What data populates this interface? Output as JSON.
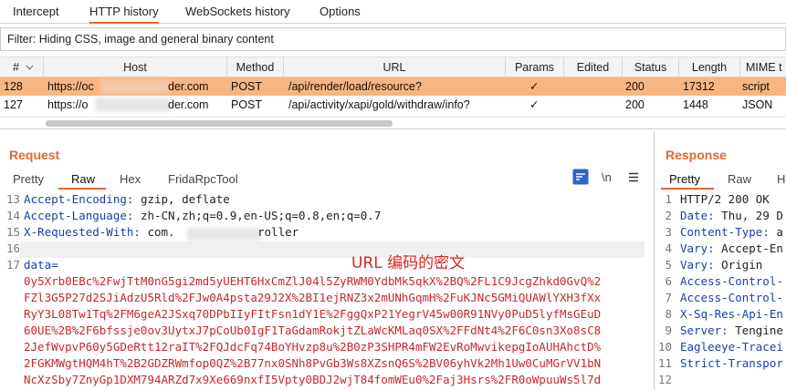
{
  "topnav": {
    "tabs": [
      "Intercept",
      "HTTP history",
      "WebSockets history",
      "Options"
    ]
  },
  "filter": {
    "text": "Filter: Hiding CSS, image and general binary content"
  },
  "table": {
    "headers": [
      "#",
      "Host",
      "Method",
      "URL",
      "Params",
      "Edited",
      "Status",
      "Length",
      "MIME t"
    ],
    "rows": [
      {
        "num": "128",
        "host_start": "https://oc",
        "host_end": "der.com",
        "method": "POST",
        "url": "/api/render/load/resource?",
        "params": "✓",
        "edited": "",
        "status": "200",
        "length": "17312",
        "mime": "script",
        "selected": true
      },
      {
        "num": "127",
        "host_start": "https://o",
        "host_end": "der.com",
        "method": "POST",
        "url": "/api/activity/xapi/gold/withdraw/info?",
        "params": "✓",
        "edited": "",
        "status": "200",
        "length": "1448",
        "mime": "JSON",
        "selected": false
      }
    ]
  },
  "request": {
    "title": "Request",
    "tabs": [
      "Pretty",
      "Raw",
      "Hex",
      "FridaRpcTool"
    ],
    "active_tab": "Raw",
    "newline_toggle": "\\n",
    "lines": [
      {
        "n": "13",
        "key": "Accept-Encoding",
        "val": " gzip, deflate"
      },
      {
        "n": "14",
        "key": "Accept-Language",
        "val": " zh-CN,zh;q=0.9,en-US;q=0.8,en;q=0.7"
      },
      {
        "n": "15",
        "key": "X-Requested-With",
        "val_start": " com.",
        "val_end": "roller"
      },
      {
        "n": "16",
        "key": "",
        "val": ""
      },
      {
        "n": "17",
        "key": "data=",
        "val": ""
      }
    ],
    "body_lines": [
      "0y5Xrb0EBc%2FwjTtM0nG5gi2md5yUEHT6HxCmZlJ04l5ZyRWM0YdbMk5qkX%2BQ%2FL1C9JcgZhkd0GvQ%2",
      "FZl3G5P27d2SJiAdzU5Rld%2FJw0A4psta29J2X%2BI1ejRNZ3x2mUNhGqmH%2FuKJNc5GMiQUAWlYXH3fXx",
      "RyY3L08Tw1Tq%2FM6geA2JSxq70DPbIIyFItFsn1dY1E%2FggQxP21YegrV45w00R91NVy0PuD5lyfMsGEuD",
      "60UE%2B%2F6bfssje0ov3UytxJ7pCoUb0IgF1TaGdamRokjtZLaWcKMLaq0SX%2FFdNt4%2F6C0sn3Xo8sC8",
      "2JefWvpvP60y5GDeRtt12raIT%2FQJdcFq74BoYHvzp8u%2B0zP3SHPR4mFW2EvRoMwvikepgIoAUHAhctD%",
      "2FGKMWgtHQM4hT%2B2GDZRWmfop0QZ%2B77nx0SNh8PvGb3Ws8XZsnQ6S%2BV06yhVk2Mh1Uw0CuMGrVV1bN",
      "NcXzSby7ZnyGp1DXM794ARZd7x9Xe669nxfI5Vpty0BDJ2wjT84fomWEu0%2Faj3Hsrs%2FR0oWpuuWs5l7d"
    ],
    "annotation": "URL 编码的密文"
  },
  "response": {
    "title": "Response",
    "tabs": [
      "Pretty",
      "Raw",
      "H"
    ],
    "active_tab": "Pretty",
    "lines": [
      {
        "n": "1",
        "key": "",
        "val": "HTTP/2 200 OK"
      },
      {
        "n": "2",
        "key": "Date",
        "val": " Thu, 29 D"
      },
      {
        "n": "3",
        "key": "Content-Type",
        "val": " a"
      },
      {
        "n": "4",
        "key": "Vary",
        "val": " Accept-En"
      },
      {
        "n": "5",
        "key": "Vary",
        "val": " Origin"
      },
      {
        "n": "6",
        "key": "Access-Control-",
        "val": ""
      },
      {
        "n": "7",
        "key": "Access-Control-",
        "val": ""
      },
      {
        "n": "8",
        "key": "X-Sq-Res-Api-En",
        "val": ""
      },
      {
        "n": "9",
        "key": "Server",
        "val": " Tengine"
      },
      {
        "n": "10",
        "key": "Eagleeye-Tracei",
        "val": ""
      },
      {
        "n": "11",
        "key": "Strict-Transpor",
        "val": ""
      },
      {
        "n": "12",
        "key": "",
        "val": ""
      }
    ]
  },
  "colors": {
    "accent": "#e8672b",
    "selected_row": "#f9b57f",
    "header_key": "#1a3faa",
    "body_red": "#c8282a"
  }
}
